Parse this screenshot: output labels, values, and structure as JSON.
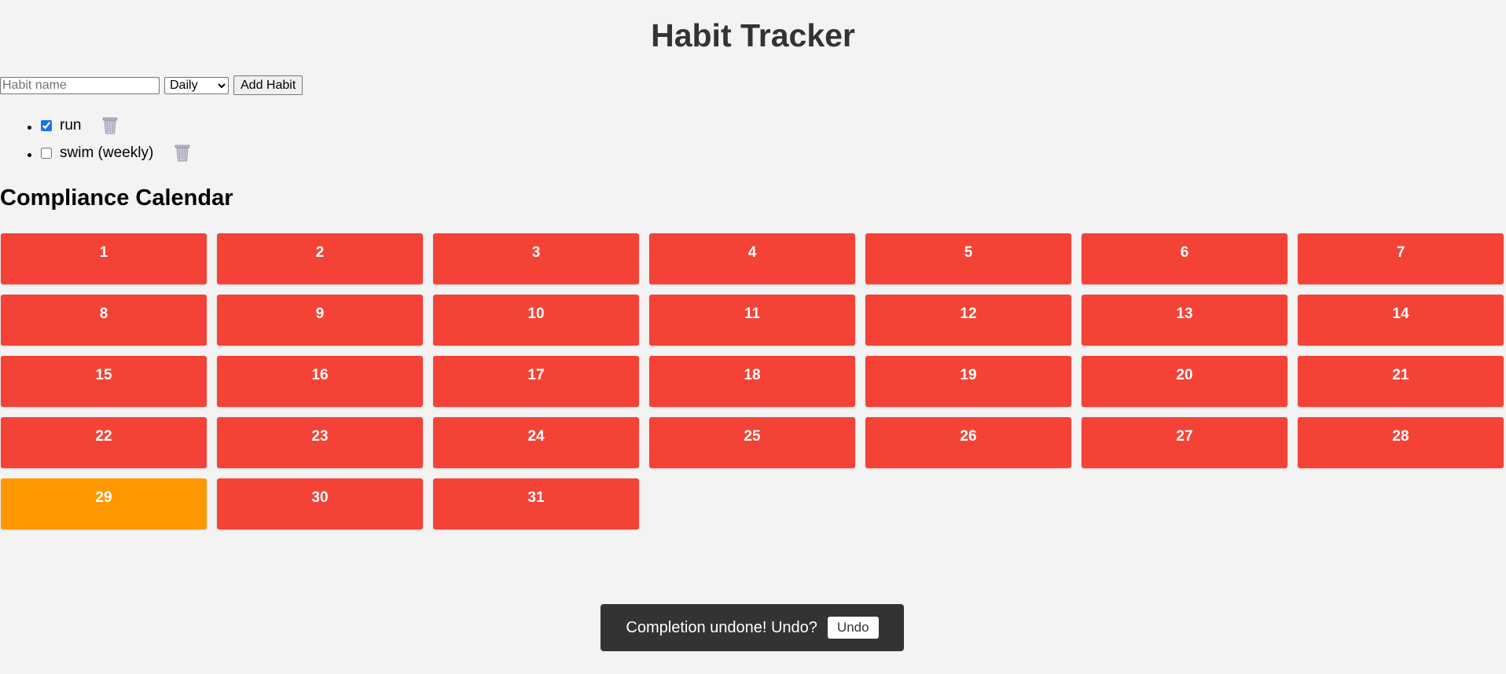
{
  "app": {
    "title": "Habit Tracker"
  },
  "add_form": {
    "name_placeholder": "Habit name",
    "name_value": "",
    "frequency_selected": "Daily",
    "frequency_options": [
      "Daily"
    ],
    "add_button_label": "Add Habit"
  },
  "habits": [
    {
      "label": "run",
      "checked": true,
      "delete_icon": "trash-icon"
    },
    {
      "label": "swim (weekly)",
      "checked": false,
      "delete_icon": "trash-icon"
    }
  ],
  "calendar": {
    "title": "Compliance Calendar",
    "colors": {
      "missed": "#f44336",
      "partial": "#ff9800"
    },
    "days": [
      {
        "label": "1",
        "status": "missed"
      },
      {
        "label": "2",
        "status": "missed"
      },
      {
        "label": "3",
        "status": "missed"
      },
      {
        "label": "4",
        "status": "missed"
      },
      {
        "label": "5",
        "status": "missed"
      },
      {
        "label": "6",
        "status": "missed"
      },
      {
        "label": "7",
        "status": "missed"
      },
      {
        "label": "8",
        "status": "missed"
      },
      {
        "label": "9",
        "status": "missed"
      },
      {
        "label": "10",
        "status": "missed"
      },
      {
        "label": "11",
        "status": "missed"
      },
      {
        "label": "12",
        "status": "missed"
      },
      {
        "label": "13",
        "status": "missed"
      },
      {
        "label": "14",
        "status": "missed"
      },
      {
        "label": "15",
        "status": "missed"
      },
      {
        "label": "16",
        "status": "missed"
      },
      {
        "label": "17",
        "status": "missed"
      },
      {
        "label": "18",
        "status": "missed"
      },
      {
        "label": "19",
        "status": "missed"
      },
      {
        "label": "20",
        "status": "missed"
      },
      {
        "label": "21",
        "status": "missed"
      },
      {
        "label": "22",
        "status": "missed"
      },
      {
        "label": "23",
        "status": "missed"
      },
      {
        "label": "24",
        "status": "missed"
      },
      {
        "label": "25",
        "status": "missed"
      },
      {
        "label": "26",
        "status": "missed"
      },
      {
        "label": "27",
        "status": "missed"
      },
      {
        "label": "28",
        "status": "missed"
      },
      {
        "label": "29",
        "status": "partial"
      },
      {
        "label": "30",
        "status": "missed"
      },
      {
        "label": "31",
        "status": "missed"
      }
    ]
  },
  "toast": {
    "message": "Completion undone! Undo?",
    "undo_label": "Undo"
  }
}
